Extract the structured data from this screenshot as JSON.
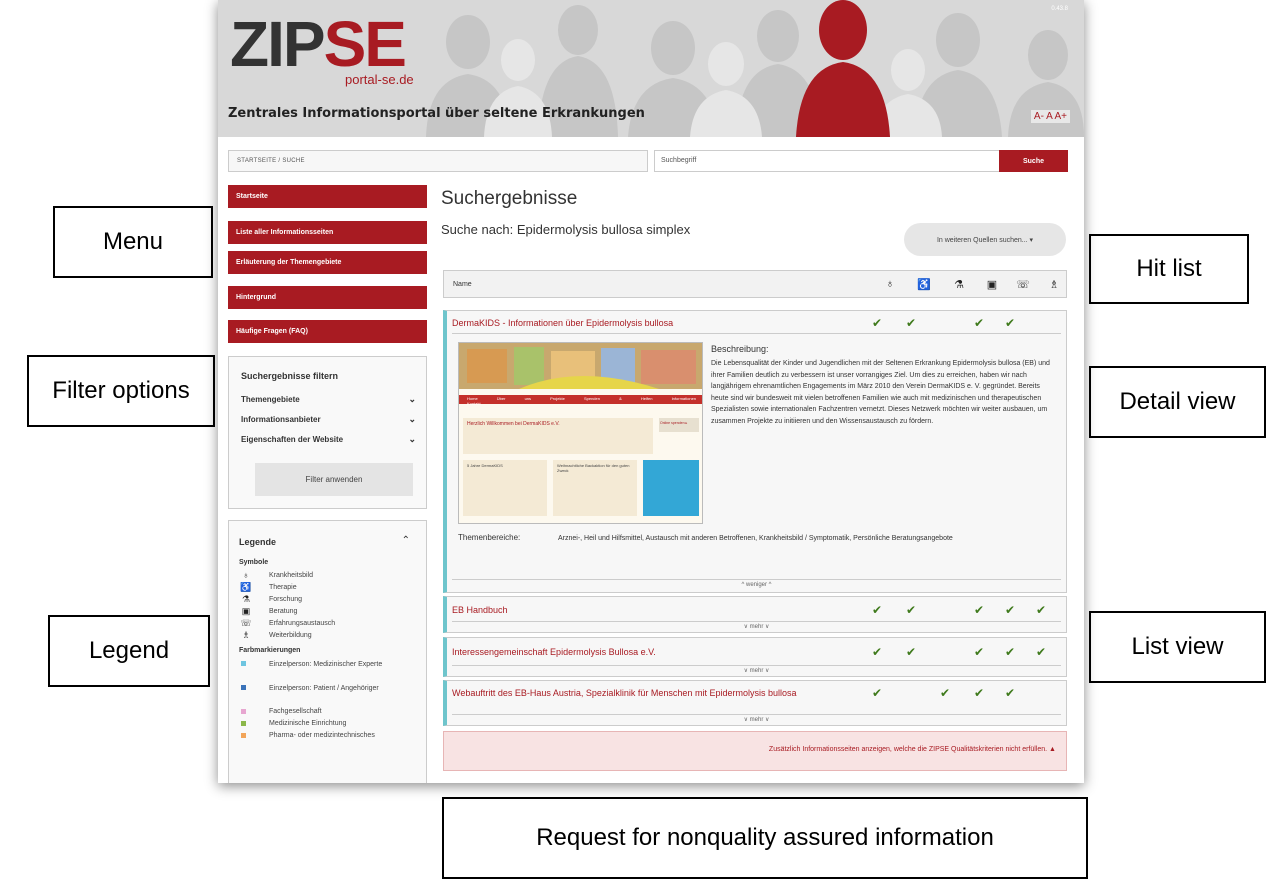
{
  "annotations": {
    "menu": "Menu",
    "filter_options": "Filter options",
    "legend": "Legend",
    "hit_list": "Hit list",
    "detail_view": "Detail view",
    "list_view": "List view",
    "request": "Request for nonquality assured information"
  },
  "header": {
    "logo_main": "ZIP",
    "logo_accent": "SE",
    "logo_sub": "portal-se.de",
    "tagline": "Zentrales Informationsportal über seltene Erkrankungen",
    "version": "0.43.8",
    "font_size_controls": "A- A A+"
  },
  "breadcrumb": "STARTSEITE / SUCHE",
  "search": {
    "placeholder": "Suchbegriff",
    "button": "Suche"
  },
  "menu": [
    "Startseite",
    "Liste aller Informationsseiten",
    "Erläuterung der Themengebiete",
    "Hintergrund",
    "Häufige Fragen (FAQ)"
  ],
  "filter": {
    "title": "Suchergebnisse filtern",
    "options": [
      "Themengebiete",
      "Informationsanbieter",
      "Eigenschaften der Website"
    ],
    "apply": "Filter anwenden"
  },
  "legend": {
    "title": "Legende",
    "symbols_title": "Symbole",
    "symbols": [
      {
        "icon": "krankheitsbild-icon",
        "glyph": "♁",
        "label": "Krankheitsbild"
      },
      {
        "icon": "therapie-icon",
        "glyph": "♿",
        "label": "Therapie"
      },
      {
        "icon": "forschung-icon",
        "glyph": "⚗",
        "label": "Forschung"
      },
      {
        "icon": "beratung-icon",
        "glyph": "▣",
        "label": "Beratung"
      },
      {
        "icon": "erfahrungsaustausch-icon",
        "glyph": "☏",
        "label": "Erfahrungsaustausch"
      },
      {
        "icon": "weiterbildung-icon",
        "glyph": "♗",
        "label": "Weiterbildung"
      }
    ],
    "colors_title": "Farbmarkierungen",
    "colors": [
      {
        "color": "#6ec5e0",
        "label": "Einzelperson: Medizinischer Experte"
      },
      {
        "color": "#3b73b9",
        "label": "Einzelperson: Patient / Angehöriger"
      },
      {
        "color": "#e7a6d0",
        "label": "Fachgesellschaft"
      },
      {
        "color": "#8cb84a",
        "label": "Medizinische Einrichtung"
      },
      {
        "color": "#f2a55a",
        "label": "Pharma- oder medizintechnisches"
      }
    ]
  },
  "results": {
    "heading": "Suchergebnisse",
    "query": "Suche nach: Epidermolysis bullosa simplex",
    "more_sources": "In weiteren Quellen suchen... ▾",
    "column_name": "Name",
    "columns": [
      "krankheitsbild-icon",
      "therapie-icon",
      "forschung-icon",
      "beratung-icon",
      "erfahrungsaustausch-icon",
      "weiterbildung-icon"
    ],
    "items": [
      {
        "title": "DermaKIDS - Informationen über Epidermolysis bullosa",
        "checks": [
          true,
          true,
          false,
          true,
          true,
          false
        ],
        "description_label": "Beschreibung:",
        "description": "Die Lebensqualität der Kinder und Jugendlichen mit der Seltenen Erkrankung Epidermolysis bullosa (EB) und ihrer Familien deutlich zu verbessern ist unser vorrangiges Ziel. Um dies zu erreichen, haben wir nach langjährigem ehrenamtlichen Engagements im März 2010 den Verein DermaKIDS e. V. gegründet. Bereits heute sind wir bundesweit mit vielen betroffenen Familien wie auch mit medizinischen und therapeutischen Spezialisten sowie internationalen Fachzentren vernetzt. Dieses Netzwerk möchten wir weiter ausbauen, um zusammen Projekte zu initiieren und den Wissensaustausch zu fördern.",
        "topics_label": "Themenbereiche:",
        "topics": "Arznei-, Heil und Hilfsmittel, Austausch mit anderen Betroffenen, Krankheitsbild / Symptomatik, Persönliche Beratungsangebote",
        "toggle": "^ weniger ^",
        "thumb": {
          "nav": [
            "Home",
            "Über uns",
            "Projekte",
            "Spenden & Helfen",
            "Informationen",
            "Kontakt"
          ],
          "welcome": "Herzlich Willkommen bei DermaKIDS e.V.",
          "online_btn": "Online spenden ▸",
          "box1": "5 Jahre DermaKIDS",
          "box2": "Weihnachtliche Backaktion für den guten Zweck"
        }
      },
      {
        "title": "EB Handbuch",
        "checks": [
          true,
          true,
          false,
          true,
          true,
          true
        ],
        "toggle": "∨ mehr ∨"
      },
      {
        "title": "Interessengemeinschaft Epidermolysis Bullosa e.V.",
        "checks": [
          true,
          true,
          false,
          true,
          true,
          true
        ],
        "toggle": "∨ mehr ∨"
      },
      {
        "title": "Webauftritt des EB-Haus Austria, Spezialklinik für Menschen mit Epidermolysis bullosa",
        "checks": [
          true,
          false,
          true,
          true,
          true,
          false
        ],
        "toggle": "∨ mehr ∨"
      }
    ],
    "non_quality": "Zusätzlich Informationsseiten anzeigen, welche die ZIPSE Qualitätskriterien nicht erfüllen. ▲"
  }
}
